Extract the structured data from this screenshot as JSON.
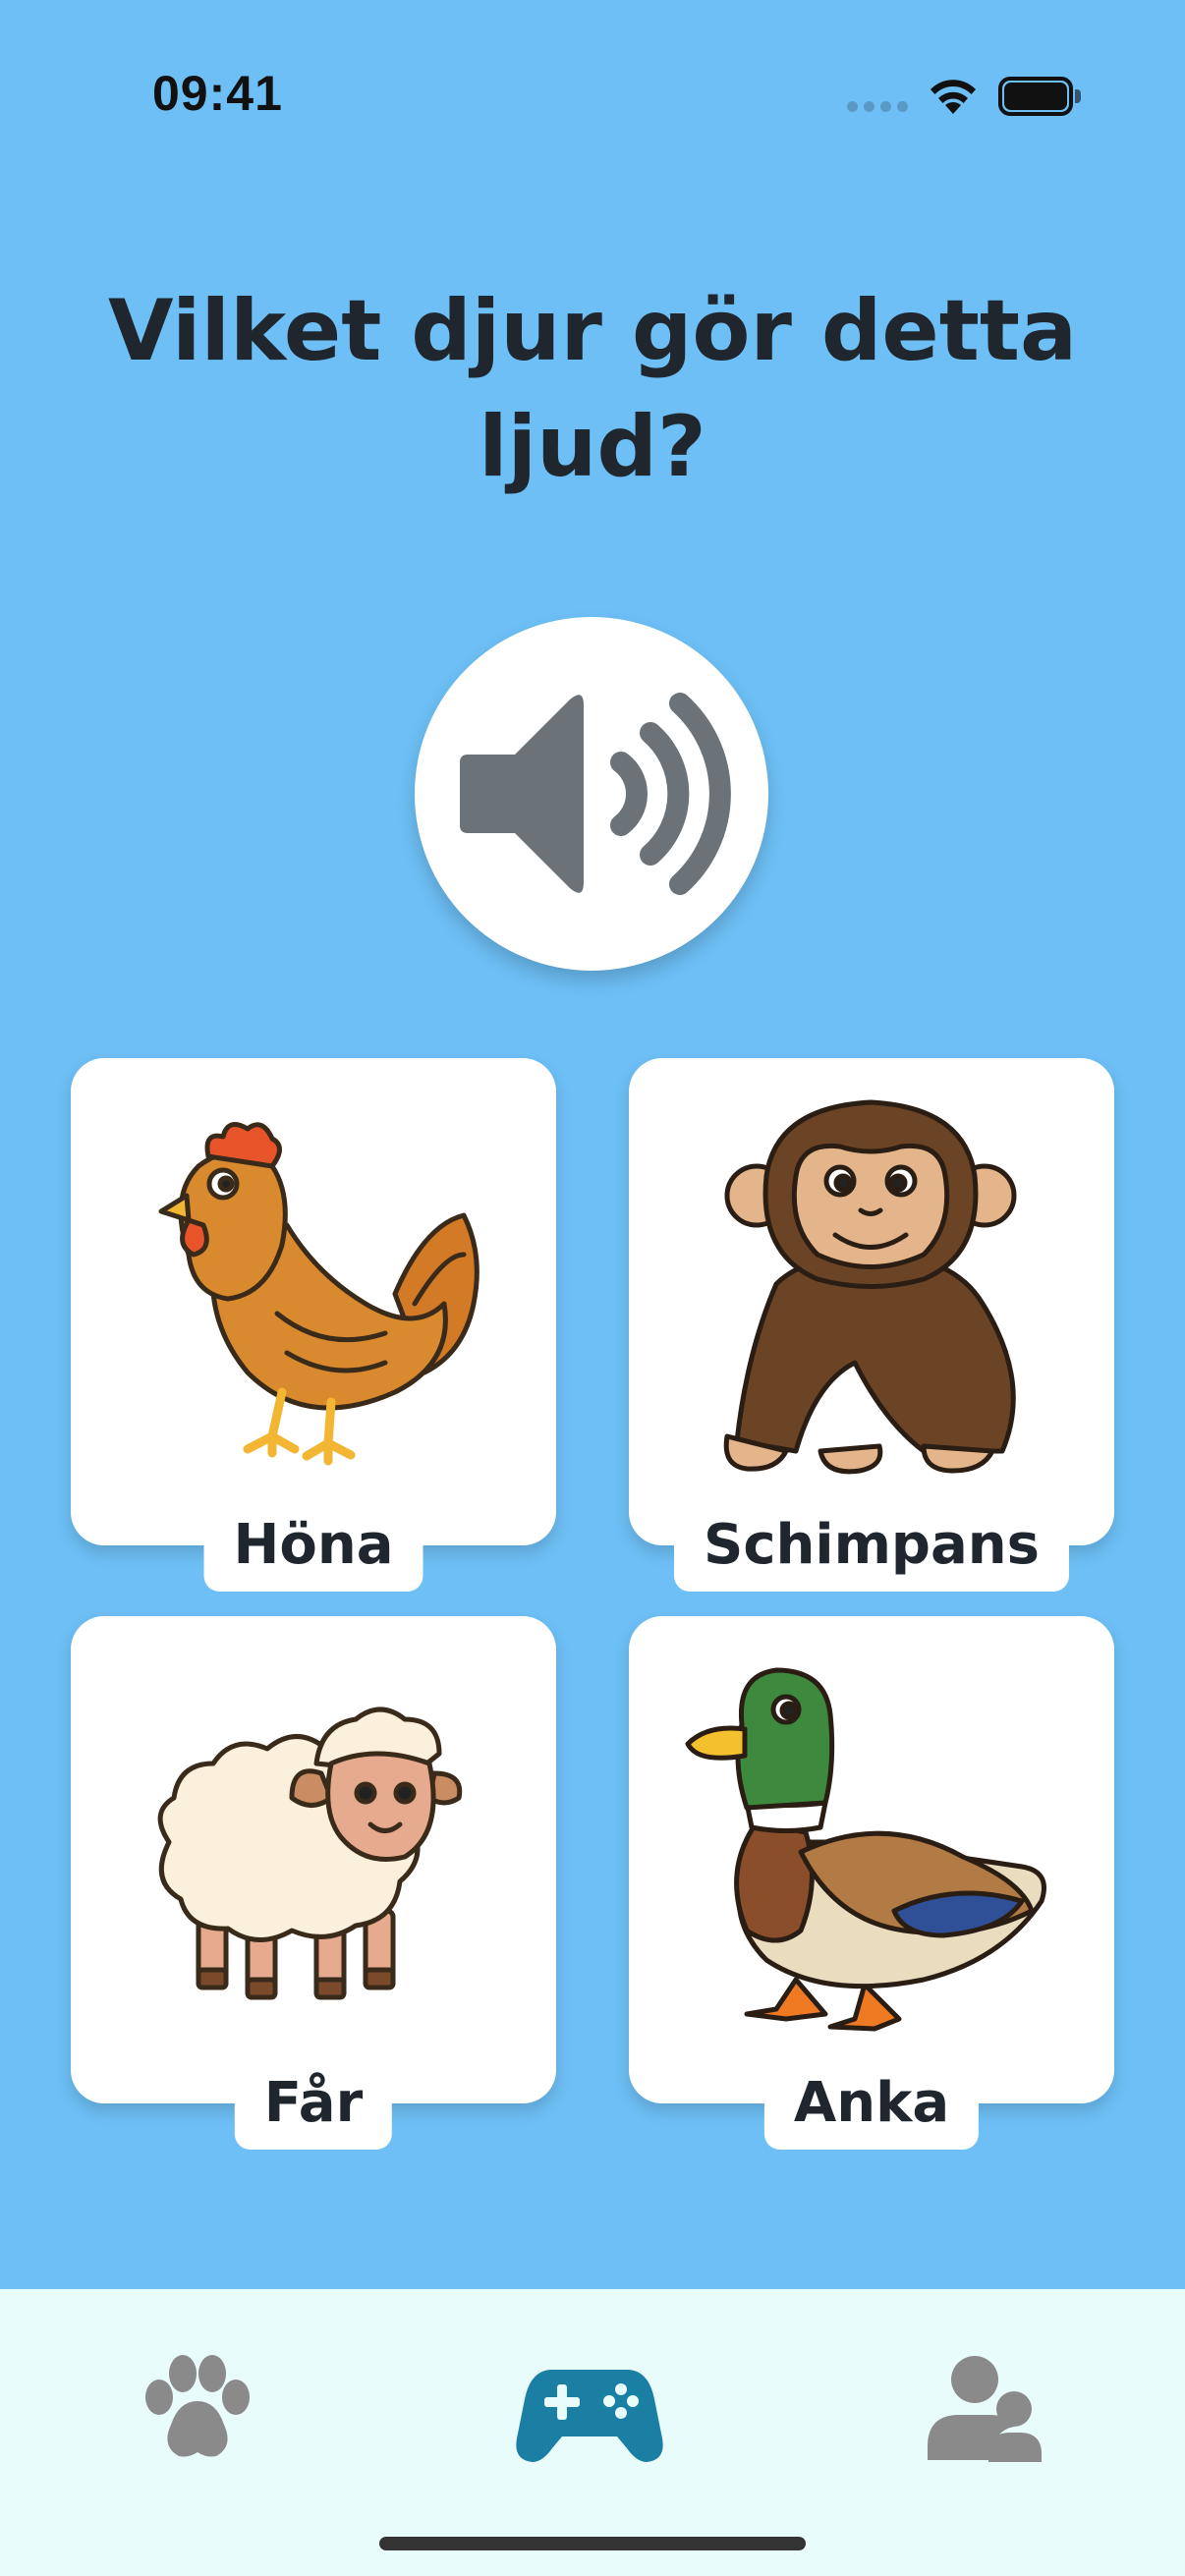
{
  "status_bar": {
    "time": "09:41"
  },
  "question": {
    "text": "Vilket djur gör detta ljud?"
  },
  "sound_button": {
    "icon": "speaker-icon"
  },
  "answers": [
    {
      "label": "Höna",
      "icon": "hen-illustration"
    },
    {
      "label": "Schimpans",
      "icon": "chimpanzee-illustration"
    },
    {
      "label": "Får",
      "icon": "sheep-illustration"
    },
    {
      "label": "Anka",
      "icon": "duck-illustration"
    }
  ],
  "tab_bar": {
    "tabs": [
      {
        "icon": "paw-icon",
        "active": false
      },
      {
        "icon": "gamepad-icon",
        "active": true
      },
      {
        "icon": "users-icon",
        "active": false
      }
    ]
  },
  "colors": {
    "background": "#6dbff5",
    "card": "#ffffff",
    "tab_bar": "#e9fcfc",
    "active_tab": "#1a7fa3",
    "inactive_tab": "#8a8a8a",
    "speaker": "#6b7379"
  }
}
